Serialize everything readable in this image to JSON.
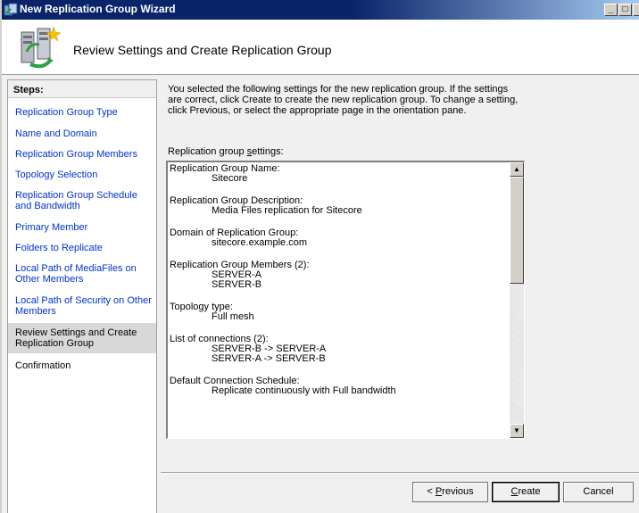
{
  "window": {
    "title": "New Replication Group Wizard",
    "icon": "replication-wizard-icon"
  },
  "header": {
    "title": "Review Settings and Create Replication Group",
    "icon": "server-replication-icon"
  },
  "sidebar": {
    "steps_label": "Steps:",
    "items": [
      {
        "label": "Replication Group Type",
        "state": "link"
      },
      {
        "label": "Name and Domain",
        "state": "link"
      },
      {
        "label": "Replication Group Members",
        "state": "link"
      },
      {
        "label": "Topology Selection",
        "state": "link"
      },
      {
        "label": "Replication Group Schedule and Bandwidth",
        "state": "link"
      },
      {
        "label": "Primary Member",
        "state": "link"
      },
      {
        "label": "Folders to Replicate",
        "state": "link"
      },
      {
        "label": "Local Path of MediaFiles on Other Members",
        "state": "link"
      },
      {
        "label": "Local Path of Security on Other Members",
        "state": "link"
      },
      {
        "label": "Review Settings and Create Replication Group",
        "state": "current"
      },
      {
        "label": "Confirmation",
        "state": "future"
      }
    ]
  },
  "main": {
    "intro": "You selected the following settings for the new replication group. If the settings are correct, click Create to create the new replication group. To change a setting, click Previous, or select the appropriate page in the orientation pane.",
    "settings_label_pre": "Replication group ",
    "settings_label_underlined": "s",
    "settings_label_post": "ettings:",
    "settings": [
      {
        "heading": "Replication Group Name:",
        "values": [
          "Sitecore"
        ]
      },
      {
        "heading": "Replication Group Description:",
        "values": [
          "Media Files replication for Sitecore"
        ]
      },
      {
        "heading": "Domain of Replication Group:",
        "values": [
          "sitecore.example.com"
        ]
      },
      {
        "heading": "Replication Group Members (2):",
        "values": [
          "SERVER-A",
          "SERVER-B"
        ]
      },
      {
        "heading": "Topology type:",
        "values": [
          "Full mesh"
        ]
      },
      {
        "heading": "List of connections (2):",
        "values": [
          "SERVER-B -> SERVER-A",
          "SERVER-A -> SERVER-B"
        ]
      },
      {
        "heading": "Default Connection Schedule:",
        "values": [
          "Replicate continuously with Full bandwidth"
        ]
      }
    ]
  },
  "buttons": {
    "previous_pre": "< ",
    "previous_underlined": "P",
    "previous_post": "revious",
    "create_underlined": "C",
    "create_post": "reate",
    "cancel": "Cancel"
  },
  "caption_buttons": {
    "minimize": "_",
    "maximize": "□",
    "close": "×"
  }
}
